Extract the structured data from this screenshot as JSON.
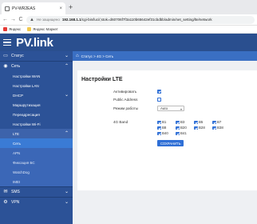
{
  "browser": {
    "tab_title": "PV-WR2EAS",
    "new_tab": "+",
    "nav_back": "←",
    "nav_forward": "→",
    "nav_reload": "C",
    "warn_icon": "▲",
    "security_text": "Не защищено",
    "url_host": "192.168.1.1",
    "url_path": "/cgi-bin/luci/;stok=d60706f7f3a110b65642ef31cbdbb/admin/net_setting/lte/network",
    "bookmarks": [
      {
        "label": "Яндекс"
      },
      {
        "label": "Яндекс Маркет"
      }
    ]
  },
  "app": {
    "logo": "PV.link",
    "breadcrumb": "Статус > 4G > Сеть"
  },
  "sidebar": {
    "status": "Статус",
    "network": "Сеть",
    "items": [
      {
        "label": "Настройки WAN"
      },
      {
        "label": "Настройки LAN"
      },
      {
        "label": "DHCP"
      },
      {
        "label": "Маршрутизация"
      },
      {
        "label": "Переадресация"
      },
      {
        "label": "Настройки Wi-Fi"
      },
      {
        "label": "LTE"
      }
    ],
    "lte_sub": [
      {
        "label": "Сеть"
      },
      {
        "label": "APN"
      },
      {
        "label": "Фиксация БС"
      },
      {
        "label": "WatchDog"
      },
      {
        "label": "IMEI"
      }
    ],
    "sms": "SMS",
    "vpn": "VPN"
  },
  "content": {
    "title": "Настройки LTE",
    "activate_label": "Активировать",
    "activate_checked": true,
    "public_address_label": "Public Address",
    "public_address_checked": false,
    "mode_label": "Режим работы",
    "mode_value": "Auto",
    "band_label": "4G Band",
    "bands": [
      {
        "name": "B1",
        "checked": true
      },
      {
        "name": "B3",
        "checked": true
      },
      {
        "name": "B5",
        "checked": true
      },
      {
        "name": "B7",
        "checked": true
      },
      {
        "name": "B8",
        "checked": true
      },
      {
        "name": "B20",
        "checked": true
      },
      {
        "name": "B28",
        "checked": true
      },
      {
        "name": "B38",
        "checked": true
      },
      {
        "name": "B40",
        "checked": true
      },
      {
        "name": "B41",
        "checked": true
      }
    ],
    "save_label": "СОХРАНИТЬ"
  },
  "colors": {
    "header": "#2a4f8f",
    "sidebar": "#2c5297",
    "accent": "#2f6fd6"
  }
}
